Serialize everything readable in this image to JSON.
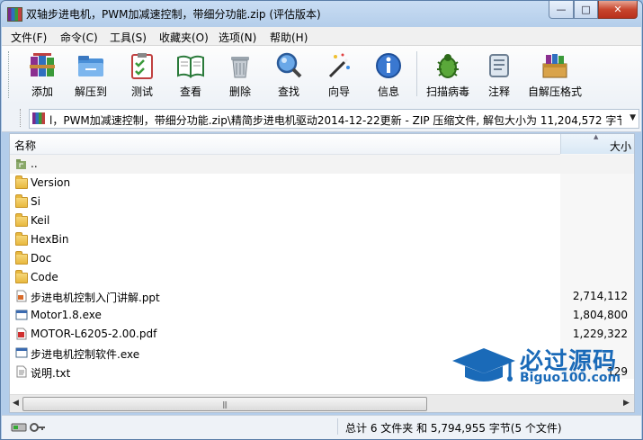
{
  "window": {
    "title": "双轴步进电机，PWM加减速控制，带细分功能.zip (评估版本)",
    "min_label": "—",
    "max_label": "□",
    "close_label": "✕"
  },
  "menu": [
    "文件(F)",
    "命令(C)",
    "工具(S)",
    "收藏夹(O)",
    "选项(N)",
    "帮助(H)"
  ],
  "toolbar": [
    {
      "label": "添加",
      "icon": "add-books-icon"
    },
    {
      "label": "解压到",
      "icon": "extract-folder-icon"
    },
    {
      "label": "测试",
      "icon": "test-checklist-icon"
    },
    {
      "label": "查看",
      "icon": "view-book-icon"
    },
    {
      "label": "删除",
      "icon": "trash-icon"
    },
    {
      "label": "查找",
      "icon": "magnifier-icon"
    },
    {
      "label": "向导",
      "icon": "wizard-wand-icon"
    },
    {
      "label": "信息",
      "icon": "info-icon"
    },
    {
      "label": "扫描病毒",
      "icon": "virus-bug-icon"
    },
    {
      "label": "注释",
      "icon": "comment-scroll-icon"
    },
    {
      "label": "自解压格式",
      "icon": "sfx-box-icon"
    }
  ],
  "address": {
    "text": "l，PWM加减速控制，带细分功能.zip\\精简步进电机驱动2014-12-22更新 - ZIP 压缩文件, 解包大小为 11,204,572 字节",
    "dropdown": "▼"
  },
  "columns": {
    "name": "名称",
    "size": "大小",
    "sort_indicator": "▲"
  },
  "files": [
    {
      "name": "..",
      "size": "",
      "type": "parent"
    },
    {
      "name": "Version",
      "size": "",
      "type": "folder"
    },
    {
      "name": "Si",
      "size": "",
      "type": "folder"
    },
    {
      "name": "Keil",
      "size": "",
      "type": "folder"
    },
    {
      "name": "HexBin",
      "size": "",
      "type": "folder"
    },
    {
      "name": "Doc",
      "size": "",
      "type": "folder"
    },
    {
      "name": "Code",
      "size": "",
      "type": "folder"
    },
    {
      "name": "步进电机控制入门讲解.ppt",
      "size": "2,714,112",
      "type": "ppt"
    },
    {
      "name": "Motor1.8.exe",
      "size": "1,804,800",
      "type": "exe"
    },
    {
      "name": "MOTOR-L6205-2.00.pdf",
      "size": "1,229,322",
      "type": "pdf"
    },
    {
      "name": "步进电机控制软件.exe",
      "size": "",
      "type": "exe"
    },
    {
      "name": "说明.txt",
      "size": "129",
      "type": "txt"
    }
  ],
  "scroll": {
    "left": "◀",
    "right": "▶",
    "grip": "|||"
  },
  "status": {
    "text": "总计 6 文件夹 和 5,794,955 字节(5 个文件)"
  },
  "watermark": {
    "big": "必过源码",
    "small": "Biguo100.com",
    "color": "#1a6ab8"
  }
}
